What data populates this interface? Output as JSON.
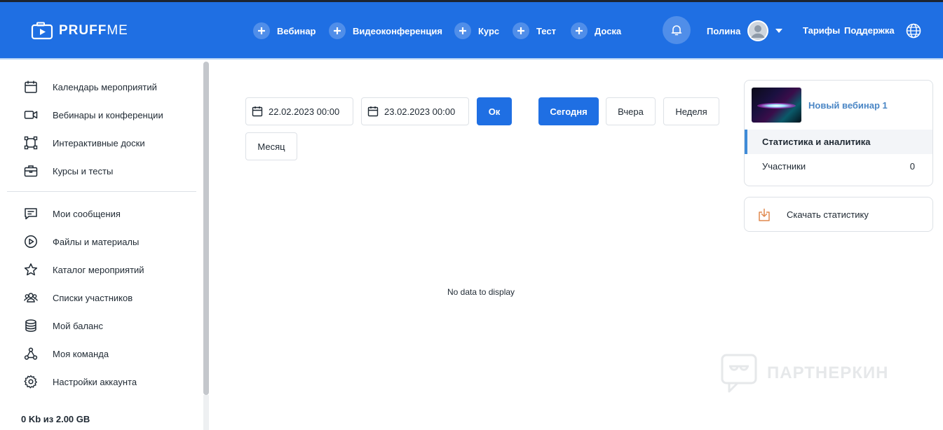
{
  "header": {
    "logo": {
      "bold": "PRUFF",
      "thin": "ME"
    },
    "create": [
      {
        "label": "Вебинар"
      },
      {
        "label": "Видеоконференция"
      },
      {
        "label": "Курс"
      },
      {
        "label": "Тест"
      },
      {
        "label": "Доска"
      }
    ],
    "user_name": "Полина",
    "links": {
      "tariffs": "Тарифы",
      "support": "Поддержка"
    }
  },
  "sidebar": {
    "items": [
      {
        "label": "Календарь мероприятий",
        "icon": "calendar-icon"
      },
      {
        "label": "Вебинары и конференции",
        "icon": "video-camera-icon"
      },
      {
        "label": "Интерактивные доски",
        "icon": "whiteboard-icon"
      },
      {
        "label": "Курсы и тесты",
        "icon": "briefcase-icon"
      },
      {
        "label": "Мои сообщения",
        "icon": "message-icon"
      },
      {
        "label": "Файлы и материалы",
        "icon": "play-circle-icon"
      },
      {
        "label": "Каталог мероприятий",
        "icon": "star-icon"
      },
      {
        "label": "Списки участников",
        "icon": "users-icon"
      },
      {
        "label": "Мой баланс",
        "icon": "database-icon"
      },
      {
        "label": "Моя команда",
        "icon": "team-nodes-icon"
      },
      {
        "label": "Настройки аккаунта",
        "icon": "gear-icon"
      }
    ],
    "storage": "0 Kb из 2.00 GB"
  },
  "filters": {
    "date_from": "22.02.2023 00:00",
    "date_to": "23.02.2023 00:00",
    "ok": "Ок",
    "today": "Сегодня",
    "yesterday": "Вчера",
    "week": "Неделя",
    "month": "Месяц"
  },
  "main": {
    "empty": "No data to display"
  },
  "event": {
    "title": "Новый вебинар 1",
    "menu": [
      {
        "label": "Статистика и аналитика"
      },
      {
        "label": "Участники",
        "count": "0"
      }
    ]
  },
  "download": {
    "label": "Скачать статистику"
  },
  "watermark": "ПАРТНЕРКИН",
  "colors": {
    "brand": "#1f6fe3",
    "accent_link": "#4a86c5",
    "download_icon": "#e0894f"
  }
}
